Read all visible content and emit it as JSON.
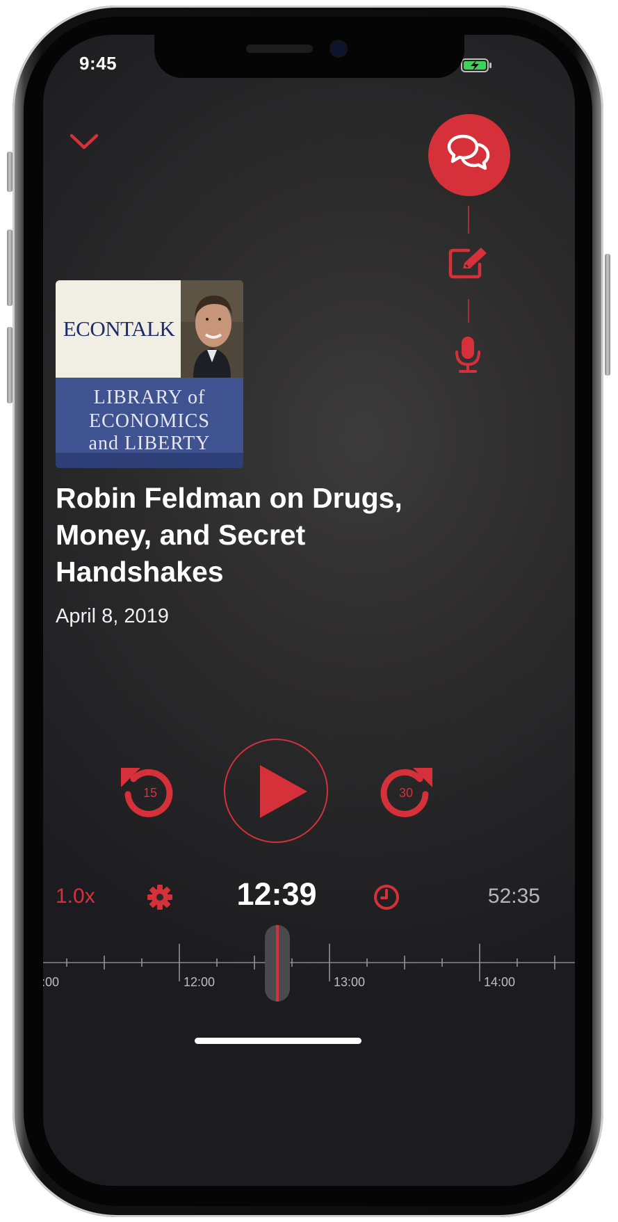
{
  "status_bar": {
    "time": "9:45"
  },
  "podcast": {
    "artwork": {
      "brand": "ECONTALK",
      "lines": [
        "LIBRARY of",
        "ECONOMICS",
        "and LIBERTY"
      ]
    },
    "episode_title": "Robin Feldman on Drugs, Money, and Secret Handshakes",
    "date": "April 8, 2019"
  },
  "player": {
    "skip_back_seconds": "15",
    "skip_forward_seconds": "30",
    "speed": "1.0x",
    "current_time": "12:39",
    "remaining_time": "52:35",
    "timeline_labels": [
      ":00",
      "12:00",
      "13:00",
      "14:00"
    ]
  },
  "colors": {
    "accent": "#d6303a",
    "background": "#2c2b2b",
    "text": "#ffffff"
  },
  "icons": [
    "chevron-down-icon",
    "chat-bubbles-icon",
    "edit-note-icon",
    "microphone-icon",
    "rewind-15-icon",
    "play-icon",
    "forward-30-icon",
    "settings-gear-icon",
    "sleep-timer-icon"
  ]
}
